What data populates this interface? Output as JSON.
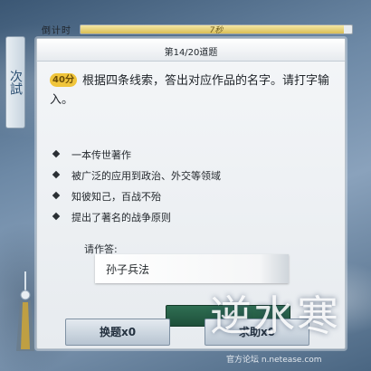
{
  "timer": {
    "label": "倒计时",
    "remaining_text": "7秒",
    "progress_fraction": 0.97
  },
  "banner": {
    "text": "次試"
  },
  "question": {
    "number_text": "第14/20道题",
    "score_badge": "40分",
    "prompt": "根据四条线索，答出对应作品的名字。请打字输入。",
    "clues": [
      "一本传世著作",
      "被广泛的应用到政治、外交等领域",
      "知彼知己，百战不殆",
      "提出了著名的战争原则"
    ]
  },
  "answer": {
    "label": "请作答:",
    "value": "孙子兵法"
  },
  "buttons": {
    "confirm_icon": "check-icon",
    "skip_label": "换题x0",
    "help_label": "求助x0"
  },
  "watermark": {
    "logo_text": "逆水寒"
  },
  "footer": {
    "site_text": "官方论坛 n.netease.com"
  },
  "colors": {
    "confirm_button": "#245c43",
    "score_badge": "#f0c53b",
    "timer_fill": "#d9be55"
  }
}
